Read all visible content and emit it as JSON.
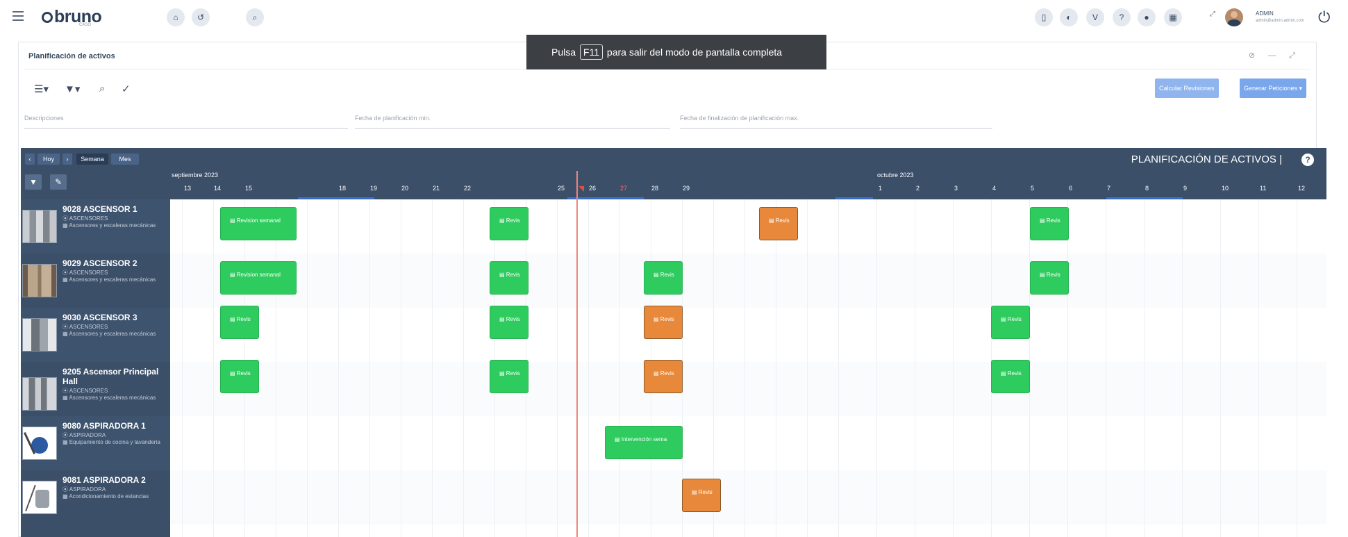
{
  "app": {
    "logo_text": "bruno",
    "logo_sub": "CASO",
    "user_name": "ADMIN",
    "user_email": "admin@admin.admin.com"
  },
  "fullscreen_toast": {
    "prefix": "Pulsa",
    "key": "F11",
    "suffix": "para salir del modo de pantalla completa"
  },
  "card": {
    "title": "Planificación de activos",
    "controls": "⊘ — ⤢",
    "buttons": {
      "calcular": "Calcular Revisiones",
      "generar": "Generar Peticiones ▾"
    },
    "fields": {
      "descripciones": "Descripciones",
      "fecha_min": "Fecha de planificación min.",
      "fecha_max": "Fecha de finalización de planificación max."
    }
  },
  "calendar": {
    "nav": {
      "prev": "‹",
      "hoy": "Hoy",
      "next": "›",
      "semana": "Semana",
      "mes": "Mes"
    },
    "title": "PLANIFICACIÓN DE ACTIVOS |",
    "help": "?",
    "months": [
      "septiembre 2023",
      "octubre 2023"
    ],
    "days": [
      "13",
      "14",
      "15",
      "18",
      "19",
      "20",
      "21",
      "22",
      "25",
      "26",
      "27",
      "28",
      "29",
      "1",
      "2",
      "3",
      "4",
      "5",
      "6",
      "7",
      "8",
      "9",
      "10",
      "11",
      "12"
    ],
    "today_day": "27"
  },
  "assets": [
    {
      "title": "9028 ASCENSOR 1",
      "type": "⦿ ASCENSORES",
      "category": "▦ Ascensores y escaleras mecánicas"
    },
    {
      "title": "9029 ASCENSOR 2",
      "type": "⦿ ASCENSORES",
      "category": "▦ Ascensores y escaleras mecánicas"
    },
    {
      "title": "9030 ASCENSOR 3",
      "type": "⦿ ASCENSORES",
      "category": "▦ Ascensores y escaleras mecánicas"
    },
    {
      "title": "9205 Ascensor Principal Hall",
      "type": "⦿ ASCENSORES",
      "category": "▦ Ascensores y escaleras mecánicas"
    },
    {
      "title": "9080 ASPIRADORA 1",
      "type": "⦿ ASPIRADORA",
      "category": "▦ Equipamiento de cocina y lavandería"
    },
    {
      "title": "9081 ASPIRADORA 2",
      "type": "⦿ ASPIRADORA",
      "category": "▦ Acondicionamiento de estancias"
    }
  ],
  "tasks": [
    {
      "label": "Revision semanal",
      "status": "green"
    },
    {
      "label": "Revis",
      "status": "green"
    },
    {
      "label": "Revis",
      "status": "orange"
    },
    {
      "label": "Revis",
      "status": "green"
    },
    {
      "label": "Revision semanal",
      "status": "green"
    },
    {
      "label": "Revis",
      "status": "green"
    },
    {
      "label": "Revis",
      "status": "green"
    },
    {
      "label": "Revis",
      "status": "green"
    },
    {
      "label": "Revis",
      "status": "green"
    },
    {
      "label": "Revis",
      "status": "green"
    },
    {
      "label": "Revis",
      "status": "orange"
    },
    {
      "label": "Revis",
      "status": "green"
    },
    {
      "label": "Revis",
      "status": "green"
    },
    {
      "label": "Revis",
      "status": "green"
    },
    {
      "label": "Revis",
      "status": "orange"
    },
    {
      "label": "Revis",
      "status": "green"
    },
    {
      "label": "Intervención sema",
      "status": "green"
    },
    {
      "label": "Revis",
      "status": "orange"
    }
  ],
  "colors": {
    "header_bg": "#3b4f69",
    "task_green": "#2ecc5f",
    "task_orange": "#e8883a",
    "today_line": "#f0847a",
    "button_blue": "#8fb4ee"
  }
}
